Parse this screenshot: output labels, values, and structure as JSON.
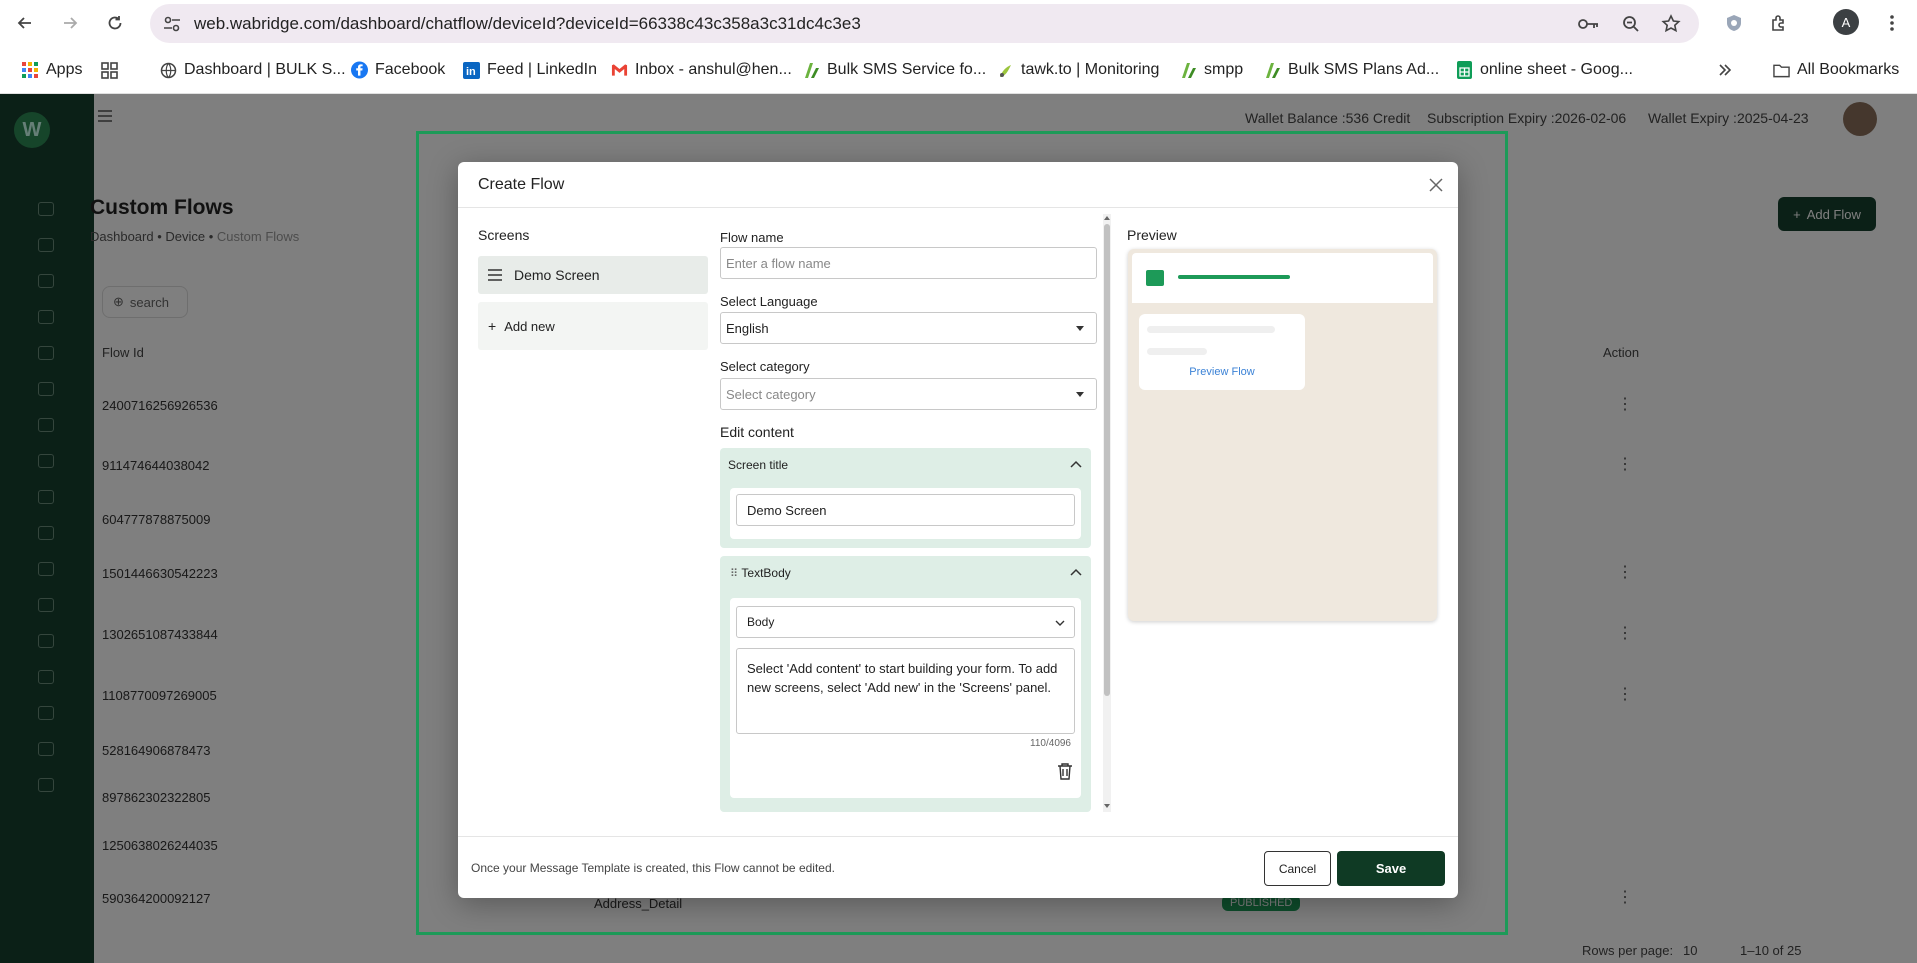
{
  "browser": {
    "url": "web.wabridge.com/dashboard/chatflow/deviceId?deviceId=66338c43c358a3c31dc4c3e3",
    "profile_initial": "A",
    "bookmarks": [
      {
        "label": "Apps",
        "icon": "apps-grid-icon"
      },
      {
        "label": "",
        "icon": "grid-icon"
      },
      {
        "label": "Dashboard | BULK S...",
        "icon": "globe-icon"
      },
      {
        "label": "Facebook",
        "icon": "facebook-icon"
      },
      {
        "label": "Feed | LinkedIn",
        "icon": "linkedin-icon"
      },
      {
        "label": "Inbox - anshul@hen...",
        "icon": "gmail-icon"
      },
      {
        "label": "Bulk SMS Service fo...",
        "icon": "bulksms-icon"
      },
      {
        "label": "tawk.to | Monitoring",
        "icon": "tawk-icon"
      },
      {
        "label": "smpp",
        "icon": "bulksms-icon"
      },
      {
        "label": "Bulk SMS Plans Ad...",
        "icon": "bulksms-icon"
      },
      {
        "label": "online sheet - Goog...",
        "icon": "sheets-icon"
      }
    ],
    "all_bookmarks": "All Bookmarks",
    "colors": {
      "omnibox": "#f0e9f1"
    }
  },
  "background_page": {
    "wallet_balance": "Wallet Balance :536 Credit",
    "subscription_expiry": "Subscription Expiry :2026-02-06",
    "wallet_expiry": "Wallet Expiry :2025-04-23",
    "title": "Custom Flows",
    "breadcrumb": [
      "Dashboard",
      "Device",
      "Custom Flows"
    ],
    "add_flow": "Add Flow",
    "search": "search",
    "columns": {
      "flow_id": "Flow Id",
      "action": "Action"
    },
    "rows": [
      "2400716256926536",
      "911474644038042",
      "604777878875009",
      "1501446630542223",
      "1302651087433844",
      "1108770097269005",
      "528164906878473",
      "897862302322805",
      "1250638026244035",
      "590364200092127"
    ],
    "last_row_name": "Address_Detail",
    "last_row_status": "PUBLISHED",
    "rows_per_page_label": "Rows per page:",
    "rows_per_page_value": "10",
    "pagination": "1–10 of 25",
    "colors": {
      "sidebar": "#17412f",
      "accent": "#1d9a58"
    }
  },
  "modal": {
    "title": "Create Flow",
    "screens": {
      "heading": "Screens",
      "items": [
        "Demo Screen"
      ],
      "add_new": "Add new"
    },
    "form": {
      "flow_name_label": "Flow name",
      "flow_name_placeholder": "Enter a flow name",
      "language_label": "Select Language",
      "language_value": "English",
      "category_label": "Select category",
      "category_placeholder": "Select category",
      "edit_content": "Edit content",
      "screen_title_section": "Screen title",
      "screen_title_value": "Demo Screen",
      "textbody_section": "TextBody",
      "body_type": "Body",
      "body_text": "Select 'Add content' to start building your form. To add new screens, select 'Add new' in the 'Screens' panel.",
      "char_counter": "110/4096"
    },
    "preview": {
      "heading": "Preview",
      "link": "Preview Flow"
    },
    "footer": {
      "note": "Once your Message Template is created, this Flow cannot be edited.",
      "cancel": "Cancel",
      "save": "Save"
    },
    "colors": {
      "section_bg": "#deeee6",
      "save_bg": "#0f3a24",
      "preview_bg": "#efe8de",
      "link": "#3b82d6"
    }
  }
}
